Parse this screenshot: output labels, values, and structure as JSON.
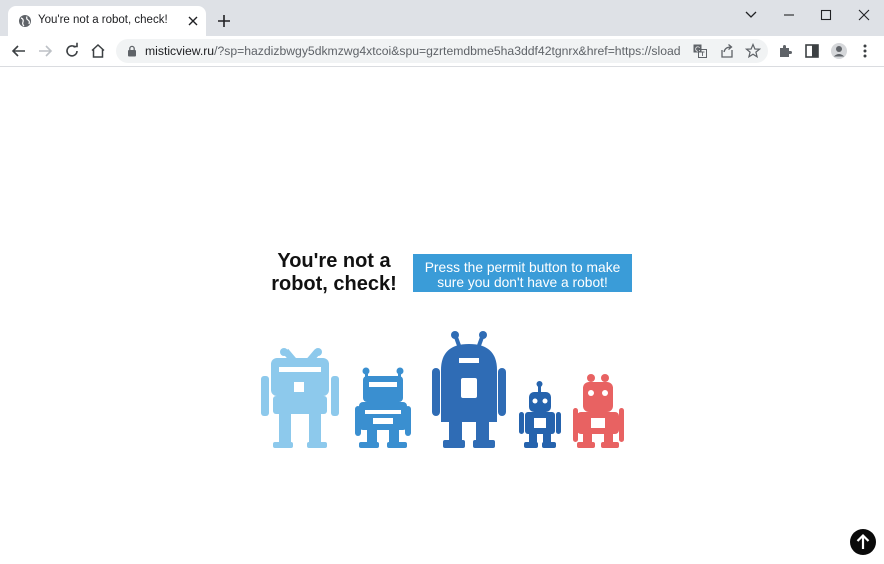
{
  "browser": {
    "tab_title": "You're not a robot, check!",
    "url_host": "misticview.ru",
    "url_rest": "/?sp=hazdizbwgy5dkmzwg4xtcoi&spu=gzrtemdbme5ha3ddf42tgnrx&href=https://sload.s..."
  },
  "page": {
    "headline_line1": "You're not a",
    "headline_line2": "robot, check!",
    "permit_line1": "Press the permit button to make",
    "permit_line2": "sure you don't have a robot!"
  },
  "colors": {
    "robot_light_blue": "#8dc9ec",
    "robot_mid_blue": "#3a8fd0",
    "robot_dark_blue": "#2f6cb5",
    "robot_navy": "#2563ad",
    "robot_red": "#e86262",
    "button_blue": "#3a9cd8"
  }
}
